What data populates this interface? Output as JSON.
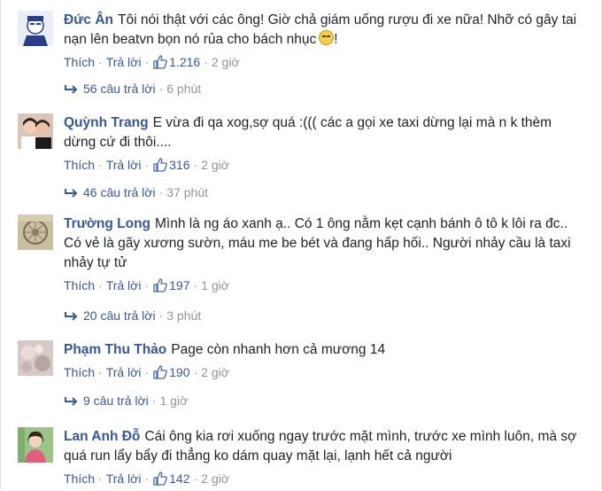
{
  "comments": [
    {
      "name": "Đức Ân",
      "text": "Tôi nói thật với các ông! Giờ chả giám uống rượu đi xe nữa! Nhỡ có gây tai nạn lên beatvn bọn nó rủa cho bách nhục",
      "emoji": "smiley-emoji",
      "like_label": "Thích",
      "reply_label": "Trả lời",
      "likes": "1.216",
      "time": "2 giờ",
      "replies": "56 câu trả lời",
      "reply_time": "6 phút"
    },
    {
      "name": "Quỳnh Trang",
      "text": "E vừa đi qa xog,sợ quá :((( các a gọi xe taxi dừng lại mà n k thèm dừng cứ đi thôi....",
      "like_label": "Thích",
      "reply_label": "Trả lời",
      "likes": "316",
      "time": "2 giờ",
      "replies": "46 câu trả lời",
      "reply_time": "37 phút"
    },
    {
      "name": "Trường Long",
      "text": "Mình là ng áo xanh ạ.. Có 1 ông nằm kẹt cạnh bánh ô tô k lôi ra đc.. Có vẻ là gãy xương sườn, máu me be bét và đang hấp hối.. Người nhảy cầu là taxi nhảy tự tử",
      "like_label": "Thích",
      "reply_label": "Trả lời",
      "likes": "197",
      "time": "1 giờ",
      "replies": "20 câu trả lời",
      "reply_time": "3 phút"
    },
    {
      "name": "Phạm Thu Thảo",
      "text": "Page còn nhanh hơn cả mương 14",
      "like_label": "Thích",
      "reply_label": "Trả lời",
      "likes": "190",
      "time": "2 giờ",
      "replies": "9 câu trả lời",
      "reply_time": "1 giờ"
    },
    {
      "name": "Lan Anh Đỗ",
      "text": "Cái ông kia rơi xuống ngay trước mặt mình, trước xe mình luôn, mà sợ quá run lẩy bẩy đi thẳng ko dám quay mặt lại, lạnh hết cả người",
      "like_label": "Thích",
      "reply_label": "Trả lời",
      "likes": "142",
      "time": "2 giờ"
    }
  ],
  "colors": {
    "name": "#365899",
    "text": "#1d2129",
    "meta": "#90949c",
    "like_icon": "#4267b2"
  },
  "icons": {
    "like": "thumbs-up-icon",
    "reply": "reply-arrow-icon"
  }
}
